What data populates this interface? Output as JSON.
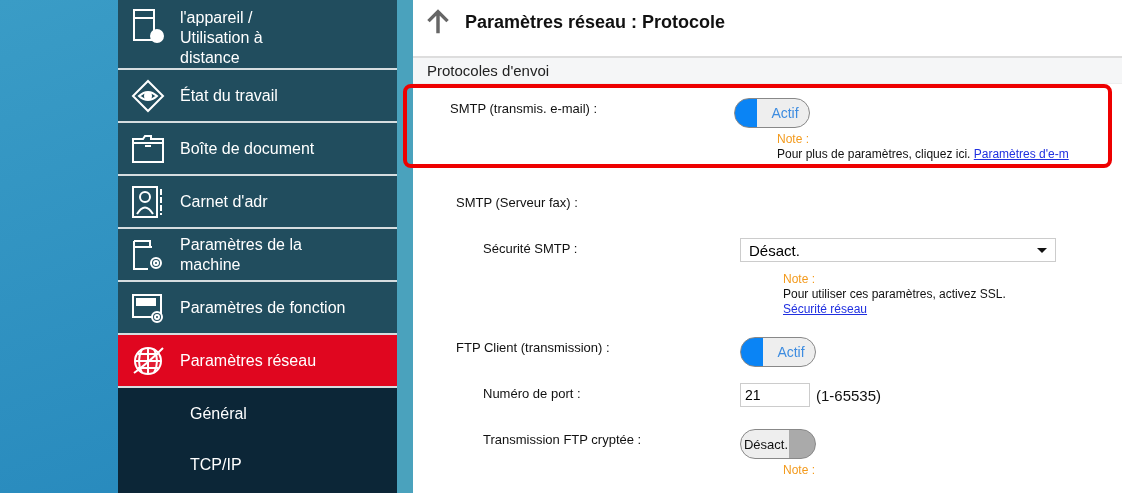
{
  "sidebar": {
    "items": [
      {
        "label": "l'appareil / Utilisation à distance",
        "selected": false
      },
      {
        "label": "État du travail",
        "selected": false
      },
      {
        "label": "Boîte de document",
        "selected": false
      },
      {
        "label": "Carnet d'adr",
        "selected": false
      },
      {
        "label": "Paramètres de la machine",
        "selected": false
      },
      {
        "label": "Paramètres de fonction",
        "selected": false
      },
      {
        "label": "Paramètres réseau",
        "selected": true
      }
    ],
    "subitems": [
      {
        "label": "Général"
      },
      {
        "label": "TCP/IP"
      }
    ]
  },
  "page": {
    "title": "Paramètres réseau : Protocole",
    "section": "Protocoles d'envoi",
    "settings": [
      {
        "label": "SMTP (transmis. e-mail) :",
        "kind": "toggle",
        "on": true,
        "value": "Actif",
        "highlighted": true,
        "note": {
          "label": "Note :",
          "text": "Pour plus de paramètres, cliquez ici.",
          "link": "Paramètres d'e-m"
        }
      },
      {
        "label": "SMTP (Serveur fax) :",
        "kind": "heading",
        "highlighted": false,
        "children": [
          {
            "label": "Sécurité SMTP :",
            "kind": "select",
            "value": "Désact.",
            "note": {
              "label": "Note :",
              "text": "Pour utiliser ces paramètres, activez SSL.",
              "link": "Sécurité réseau"
            }
          }
        ]
      },
      {
        "label": "FTP Client (transmission) :",
        "kind": "toggle",
        "on": true,
        "value": "Actif",
        "highlighted": false,
        "children": [
          {
            "label": "Numéro de port :",
            "kind": "input",
            "value": "21",
            "hint": "(1-65535)"
          },
          {
            "label": "Transmission FTP cryptée :",
            "kind": "toggle",
            "on": false,
            "value": "Désact.",
            "note": {
              "label": "Note :"
            }
          }
        ]
      }
    ]
  }
}
